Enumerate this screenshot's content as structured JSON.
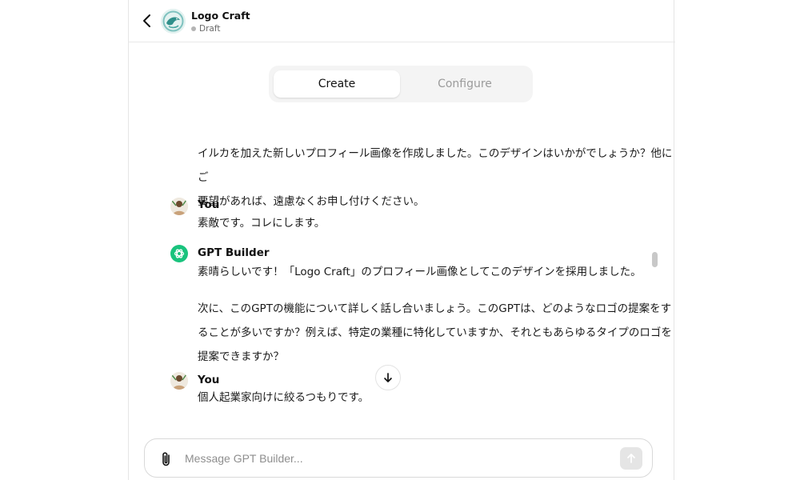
{
  "header": {
    "title": "Logo Craft",
    "status": "Draft"
  },
  "tabs": [
    {
      "label": "Create",
      "active": true
    },
    {
      "label": "Configure",
      "active": false
    }
  ],
  "messages": {
    "m0": {
      "lines": [
        "イルカを加えた新しいプロフィール画像を作成しました。このデザインはいかがでしょうか？他にご",
        "要望があれば、遠慮なくお申し付けください。"
      ]
    },
    "m1": {
      "sender": "You",
      "lines": [
        "素敵です。コレにします。"
      ]
    },
    "m2": {
      "sender": "GPT Builder",
      "lines": [
        "素晴らしいです！「Logo Craft」のプロフィール画像としてこのデザインを採用しました。",
        "次に、このGPTの機能について詳しく話し合いましょう。このGPTは、どのようなロゴの提案をす",
        "ることが多いですか？例えば、特定の業種に特化していますか、それともあらゆるタイプのロゴを",
        "提案できますか？"
      ]
    },
    "m3": {
      "sender": "You",
      "lines": [
        "個人起業家向けに絞るつもりです。"
      ]
    }
  },
  "composer": {
    "placeholder": "Message GPT Builder...",
    "value": ""
  },
  "icons": {
    "back": "chevron-left-icon",
    "attach": "paperclip-icon",
    "send": "arrow-up-icon",
    "scroll_down": "arrow-down-icon",
    "bot": "openai-logo-icon"
  },
  "colors": {
    "bot_avatar": "#19c37d",
    "active_tab_bg": "#ffffff",
    "tab_bar_bg": "#f4f4f4",
    "inactive_tab_text": "#9b9b9b"
  }
}
